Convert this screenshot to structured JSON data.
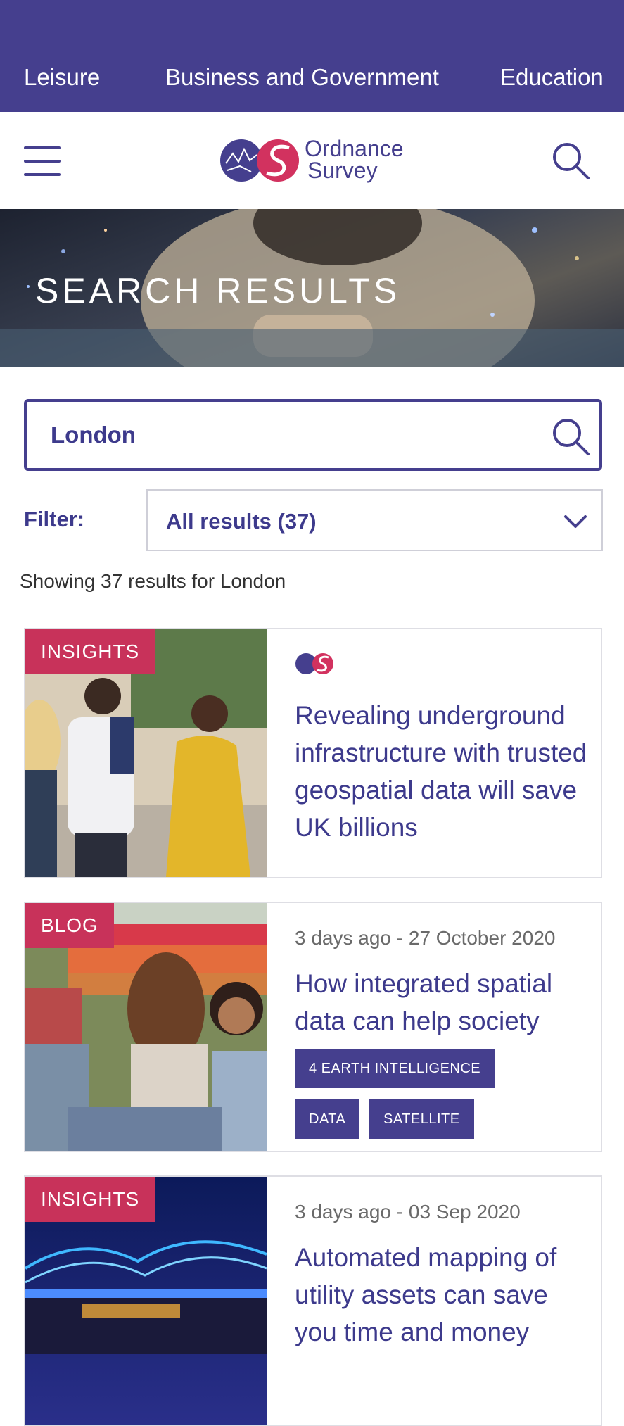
{
  "topnav": {
    "items": [
      "Leisure",
      "Business and Government",
      "Education"
    ]
  },
  "header": {
    "logo_line1": "Ordnance",
    "logo_line2": "Survey"
  },
  "hero": {
    "title": "SEARCH RESULTS"
  },
  "search": {
    "value": "London"
  },
  "filter": {
    "label": "Filter:",
    "selected": "All results (37)"
  },
  "results_summary": "Showing 37 results for London",
  "cards": [
    {
      "tag": "INSIGHTS",
      "title": "Revealing underground infrastructure with trusted geospatial data will save UK billions"
    },
    {
      "tag": "BLOG",
      "date": "3 days ago - 27 October  2020",
      "title": "How integrated spatial data can help society",
      "chips": [
        "4 EARTH INTELLIGENCE",
        "DATA",
        "SATELLITE"
      ]
    },
    {
      "tag": "INSIGHTS",
      "date": "3 days ago - 03 Sep 2020",
      "title": "Automated mapping of utility assets can save you time and money"
    }
  ],
  "colors": {
    "brand_purple": "#453f8e",
    "tag_red": "#c8325a",
    "link_text": "#3d3a8c"
  }
}
